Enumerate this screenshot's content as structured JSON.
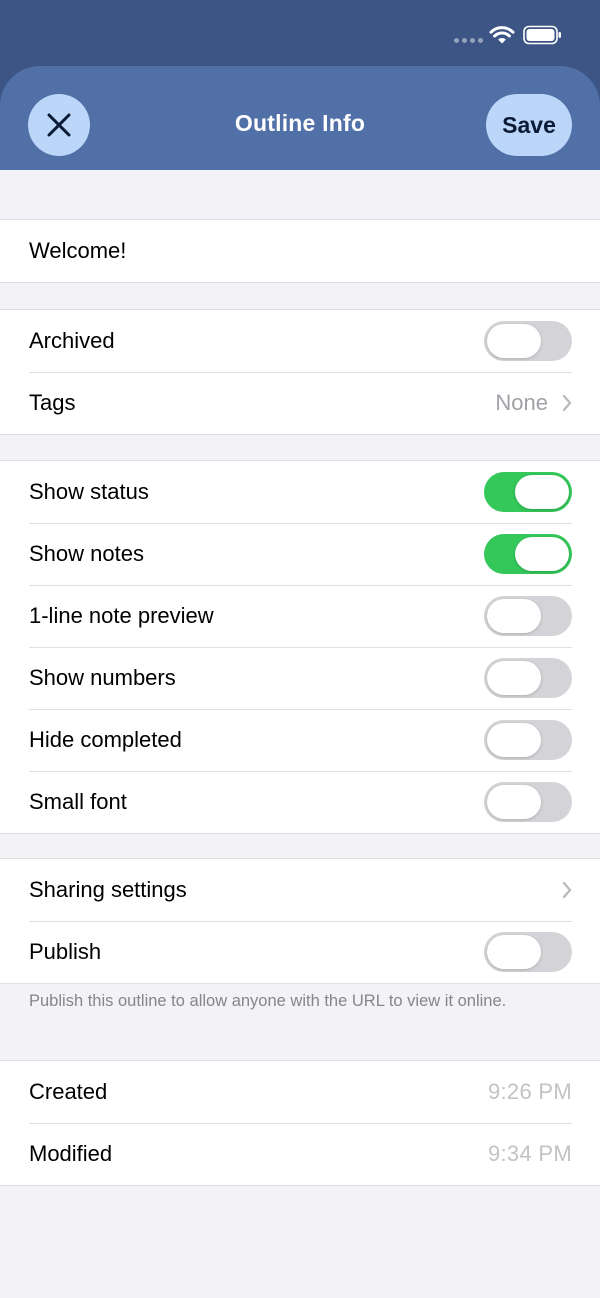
{
  "header": {
    "title": "Outline Info",
    "close_icon": "close-icon",
    "save_label": "Save"
  },
  "status_bar": {
    "icons": [
      "signal-dots",
      "wifi-icon",
      "battery-icon"
    ]
  },
  "title_field": {
    "value": "Welcome!"
  },
  "general": {
    "archived": {
      "label": "Archived",
      "on": false
    },
    "tags": {
      "label": "Tags",
      "value": "None"
    }
  },
  "display": {
    "show_status": {
      "label": "Show status",
      "on": true
    },
    "show_notes": {
      "label": "Show notes",
      "on": true
    },
    "note_preview": {
      "label": "1-line note preview",
      "on": false
    },
    "show_numbers": {
      "label": "Show numbers",
      "on": false
    },
    "hide_completed": {
      "label": "Hide completed",
      "on": false
    },
    "small_font": {
      "label": "Small font",
      "on": false
    }
  },
  "sharing": {
    "sharing_settings": {
      "label": "Sharing settings"
    },
    "publish": {
      "label": "Publish",
      "on": false
    },
    "footnote": "Publish this outline to allow anyone with the URL to view it online."
  },
  "dates": {
    "created": {
      "label": "Created",
      "value": "9:26 PM"
    },
    "modified": {
      "label": "Modified",
      "value": "9:34 PM"
    }
  },
  "colors": {
    "header": "#5170a8",
    "button_fill": "#bcd6f9",
    "toggle_on": "#34c759",
    "toggle_off": "#d4d4d8",
    "background": "#f2f2f7"
  }
}
